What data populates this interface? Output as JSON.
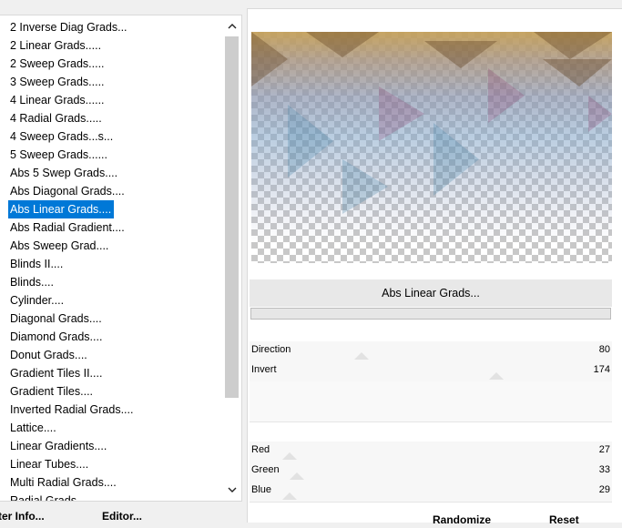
{
  "filter_list": {
    "items": [
      "2 Inverse Diag Grads...",
      "2 Linear Grads.....",
      "2 Sweep Grads.....",
      "3 Sweep Grads.....",
      "4 Linear Grads......",
      "4 Radial Grads.....",
      "4 Sweep Grads...s...",
      "5 Sweep Grads......",
      "Abs 5 Swep Grads....",
      "Abs Diagonal Grads....",
      "Abs Linear Grads....",
      "Abs Radial Gradient....",
      "Abs Sweep Grad....",
      "Blinds II....",
      "Blinds....",
      "Cylinder....",
      "Diagonal Grads....",
      "Diamond Grads....",
      "Donut Grads....",
      "Gradient Tiles II....",
      "Gradient Tiles....",
      "Inverted Radial Grads....",
      "Lattice....",
      "Linear Gradients....",
      "Linear Tubes....",
      "Multi Radial Grads....",
      "Radial Grads...."
    ],
    "selected": "Abs Linear Grads...."
  },
  "buttons": {
    "filter_info": "ter Info...",
    "editor": "Editor...",
    "randomize": "Randomize",
    "reset": "Reset"
  },
  "filter_title": "Abs Linear Grads...",
  "sliders": [
    {
      "label": "Direction",
      "value": "80",
      "level": 0.31
    },
    {
      "label": "Invert",
      "value": "174",
      "level": 0.68
    },
    {
      "label": "",
      "value": "",
      "level": null
    },
    {
      "label": "",
      "value": "",
      "level": null
    },
    {
      "label": "Red",
      "value": "27",
      "level": 0.11
    },
    {
      "label": "Green",
      "value": "33",
      "level": 0.13
    },
    {
      "label": "Blue",
      "value": "29",
      "level": 0.11
    }
  ],
  "icons": {
    "scroll_up": "chevron-up-icon",
    "scroll_down": "chevron-down-icon"
  }
}
